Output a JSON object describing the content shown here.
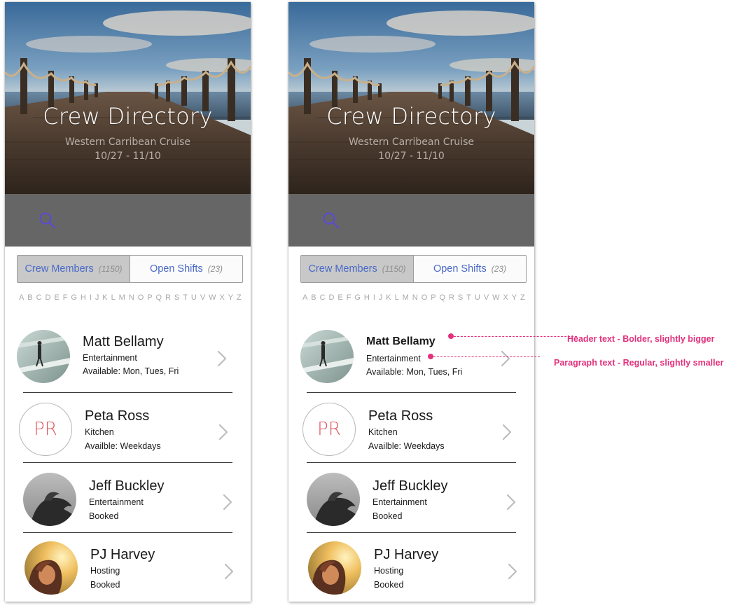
{
  "screens": [
    {
      "hero": {
        "title": "Crew Directory",
        "subtitle": "Western Carribean Cruise",
        "dates": "10/27 - 11/10"
      },
      "search": {
        "icon": "search-icon"
      },
      "tabs": [
        {
          "label": "Crew Members",
          "count": "(1150)",
          "active": true
        },
        {
          "label": "Open Shifts",
          "count": "(23)",
          "active": false
        }
      ],
      "alphabet": [
        "A",
        "B",
        "C",
        "D",
        "E",
        "F",
        "G",
        "H",
        "I",
        "J",
        "K",
        "L",
        "M",
        "N",
        "O",
        "P",
        "Q",
        "R",
        "S",
        "T",
        "U",
        "V",
        "W",
        "X",
        "Y",
        "Z"
      ],
      "members": [
        {
          "name": "Matt Bellamy",
          "dept": "Entertainment",
          "status": "Available: Mon, Tues, Fri",
          "avatar": "photo-walker"
        },
        {
          "name": "Peta Ross",
          "dept": "Kitchen",
          "status": "Availble: Weekdays",
          "initials": "PR"
        },
        {
          "name": "Jeff Buckley",
          "dept": "Entertainment",
          "status": "Booked",
          "avatar": "photo-bw-hair"
        },
        {
          "name": "PJ Harvey",
          "dept": "Hosting",
          "status": "Booked",
          "avatar": "photo-sunset"
        }
      ]
    },
    {
      "hero": {
        "title": "Crew Directory",
        "subtitle": "Western Carribean Cruise",
        "dates": "10/27 - 11/10"
      },
      "search": {
        "icon": "search-icon"
      },
      "tabs": [
        {
          "label": "Crew Members",
          "count": "(1150)",
          "active": true
        },
        {
          "label": "Open Shifts",
          "count": "(23)",
          "active": false
        }
      ],
      "members": [
        {
          "name": "Matt Bellamy",
          "dept": "Entertainment",
          "status": "Available: Mon, Tues, Fri",
          "avatar": "photo-walker"
        },
        {
          "name": "Peta Ross",
          "dept": "Kitchen",
          "status": "Availble: Weekdays",
          "initials": "PR"
        },
        {
          "name": "Jeff Buckley",
          "dept": "Entertainment",
          "status": "Booked",
          "avatar": "photo-bw-hair"
        },
        {
          "name": "PJ Harvey",
          "dept": "Hosting",
          "status": "Booked",
          "avatar": "photo-sunset"
        }
      ]
    }
  ],
  "annotations": {
    "header": "Header text - Bolder, slightly bigger",
    "paragraph": "Paragraph text - Regular, slightly smaller"
  },
  "colors": {
    "accent": "#4a6ac8",
    "search_bar": "#666666",
    "tab_active": "#c8c8c8",
    "initials": "#e05a62",
    "annotation": "#e2317c"
  }
}
